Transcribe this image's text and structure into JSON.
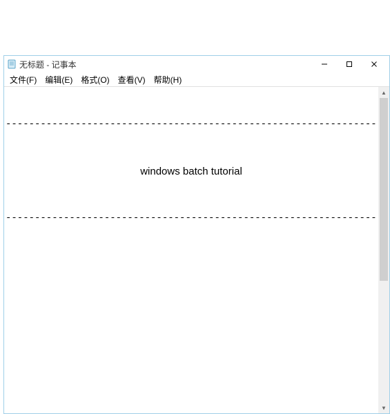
{
  "window": {
    "title": "无标题 - 记事本"
  },
  "menu": {
    "file": "文件(F)",
    "edit": "编辑(E)",
    "format": "格式(O)",
    "view": "查看(V)",
    "help": "帮助(H)"
  },
  "content": {
    "dash_line": "----------------------------------------------------------------------------------------------------------------",
    "title_line": "windows batch tutorial"
  },
  "icons": {
    "notepad": "notepad-icon",
    "minimize": "minimize-icon",
    "maximize": "maximize-icon",
    "close": "close-icon",
    "scroll_up": "scroll-up-icon",
    "scroll_down": "scroll-down-icon"
  }
}
